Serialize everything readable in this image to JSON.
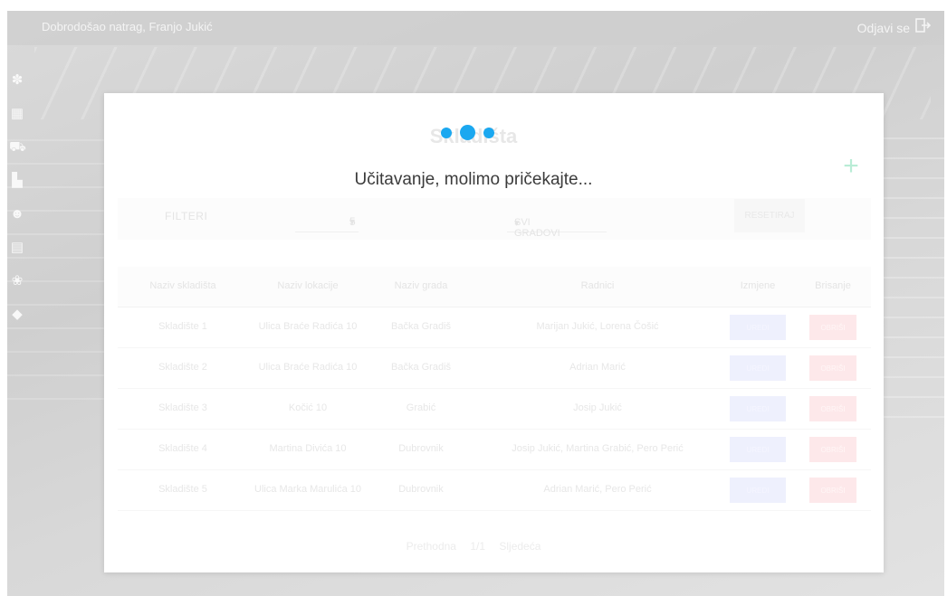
{
  "header": {
    "welcome": "Dobrodošao natrag, Franjo Jukić",
    "logout_label": "Odjavi se",
    "logout_icon": "logout-arrow-icon"
  },
  "sidebar": {
    "icons": [
      "paw-icon",
      "warehouse-icon",
      "truck-icon",
      "building-icon",
      "users-icon",
      "document-icon",
      "pets-icon",
      "bird-icon"
    ]
  },
  "main": {
    "title": "Skladišta",
    "add_icon": "plus-icon"
  },
  "filters": {
    "label": "FILTERI",
    "page_size": "5",
    "city": "SVI GRADOVI",
    "reset_label": "RESETIRAJ"
  },
  "table": {
    "headers": [
      "Naziv skladišta",
      "Naziv lokacije",
      "Naziv grada",
      "Radnici",
      "Izmjene",
      "Brisanje"
    ],
    "rows": [
      {
        "name": "Skladište 1",
        "location": "Ulica Braće Radića 10",
        "city": "Bačka Gradiš",
        "workers": "Marijan Jukić, Lorena Čošić"
      },
      {
        "name": "Skladište 2",
        "location": "Ulica Braće Radića 10",
        "city": "Bačka Gradiš",
        "workers": "Adrian Marić"
      },
      {
        "name": "Skladište 3",
        "location": "Kočić 10",
        "city": "Grabić",
        "workers": "Josip Jukić"
      },
      {
        "name": "Skladište 4",
        "location": "Martina Divića 10",
        "city": "Dubrovnik",
        "workers": "Josip Jukić, Martina Grabić, Pero Perić"
      },
      {
        "name": "Skladište 5",
        "location": "Ulica Marka Marulića 10",
        "city": "Dubrovnik",
        "workers": "Adrian Marić, Pero Perić"
      }
    ],
    "edit_label": "UREDI",
    "delete_label": "OBRIŠI"
  },
  "pagination": {
    "prev": "Prethodna",
    "page": "1/1",
    "next": "Sljedeća"
  },
  "loading": {
    "text": "Učitavanje, molimo pričekajte...",
    "dot_color": "#1ba8f0"
  }
}
